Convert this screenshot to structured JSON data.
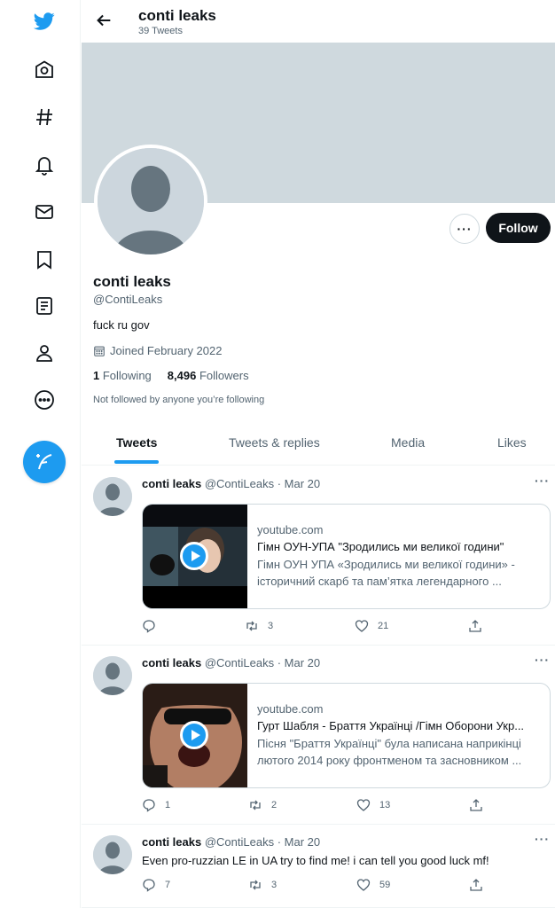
{
  "header": {
    "name": "conti leaks",
    "tweet_count": "39 Tweets"
  },
  "profile": {
    "name": "conti leaks",
    "handle": "@ContiLeaks",
    "bio": "fuck ru gov",
    "joined": "Joined February 2022",
    "following_count": "1",
    "following_label": "Following",
    "followers_count": "8,496",
    "followers_label": "Followers",
    "not_followed": "Not followed by anyone you’re following",
    "follow_button": "Follow",
    "more_button": "···"
  },
  "tabs": [
    "Tweets",
    "Tweets & replies",
    "Media",
    "Likes"
  ],
  "tweets": [
    {
      "name": "conti leaks",
      "handle": "@ContiLeaks",
      "date": " · Mar 20",
      "more": "···",
      "card": {
        "domain": "youtube.com",
        "title": "Гімн ОУН-УПА \"Зродились ми великої години\"",
        "desc": "Гімн ОУН УПА «Зродились ми великої години» - історичний скарб та пам’ятка легендарного ..."
      },
      "replies": "",
      "retweets": "3",
      "likes": "21"
    },
    {
      "name": "conti leaks",
      "handle": "@ContiLeaks",
      "date": " · Mar 20",
      "more": "···",
      "card": {
        "domain": "youtube.com",
        "title": "Гурт Шабля - Браття Українці /Гімн Оборони Укр...",
        "desc": "Пісня \"Браття Українці\" була написана наприкінці лютого 2014 року фронтменом та засновником ..."
      },
      "replies": "1",
      "retweets": "2",
      "likes": "13"
    },
    {
      "name": "conti leaks",
      "handle": "@ContiLeaks",
      "date": " · Mar 20",
      "more": "···",
      "text": "Even pro-ruzzian LE in UA try to find me! i can tell you good luck mf!",
      "replies": "7",
      "retweets": "3",
      "likes": "59"
    }
  ],
  "colors": {
    "accent": "#1d9bf0",
    "text": "#0f1419",
    "secondary": "#536471"
  }
}
